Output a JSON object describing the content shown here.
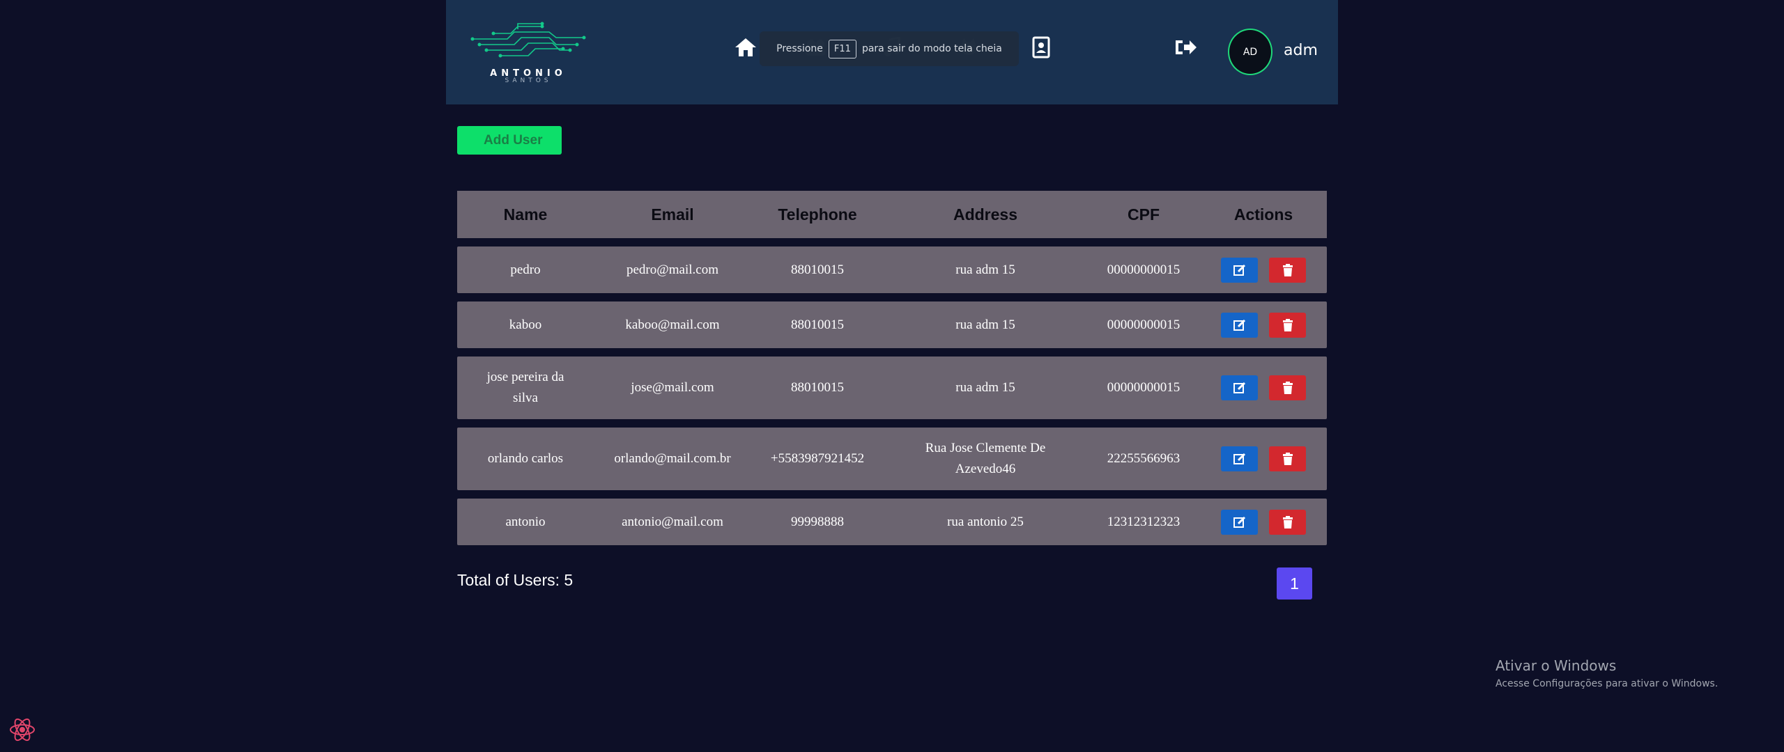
{
  "header": {
    "logo": {
      "name": "ANTONIO",
      "sub": "SANTOS"
    },
    "fullscreen_notice": {
      "before": "Pressione",
      "key": "F11",
      "after": "para sair do modo tela cheia"
    },
    "avatar_initials": "AD",
    "user_name": "adm"
  },
  "actions": {
    "add_user_label": "Add User"
  },
  "table": {
    "headers": [
      "Name",
      "Email",
      "Telephone",
      "Address",
      "CPF",
      "Actions"
    ],
    "rows": [
      {
        "name": "pedro",
        "email": "pedro@mail.com",
        "telephone": "88010015",
        "address": "rua adm 15",
        "cpf": "00000000015"
      },
      {
        "name": "kaboo",
        "email": "kaboo@mail.com",
        "telephone": "88010015",
        "address": "rua adm 15",
        "cpf": "00000000015"
      },
      {
        "name": "jose pereira da silva",
        "email": "jose@mail.com",
        "telephone": "88010015",
        "address": "rua adm 15",
        "cpf": "00000000015"
      },
      {
        "name": "orlando carlos",
        "email": "orlando@mail.com.br",
        "telephone": "+5583987921452",
        "address": "Rua Jose Clemente De Azevedo46",
        "cpf": "22255566963"
      },
      {
        "name": "antonio",
        "email": "antonio@mail.com",
        "telephone": "99998888",
        "address": "rua antonio 25",
        "cpf": "12312312323"
      }
    ]
  },
  "footer": {
    "total_label": "Total of Users: 5",
    "current_page": "1"
  },
  "windows_watermark": {
    "title": "Ativar o Windows",
    "subtitle": "Acesse Configurações para ativar o Windows."
  },
  "colors": {
    "background": "#0d0f27",
    "header": "#193150",
    "accent_green": "#0ddf6a",
    "row": "#6b6470",
    "edit": "#1565c8",
    "delete": "#d3282e",
    "pagination": "#5b48f0"
  },
  "icons": [
    "home-icon",
    "users-icon",
    "music-icon",
    "cat-icon",
    "contact-icon",
    "logout-icon",
    "edit-icon",
    "trash-icon",
    "react-icon"
  ]
}
